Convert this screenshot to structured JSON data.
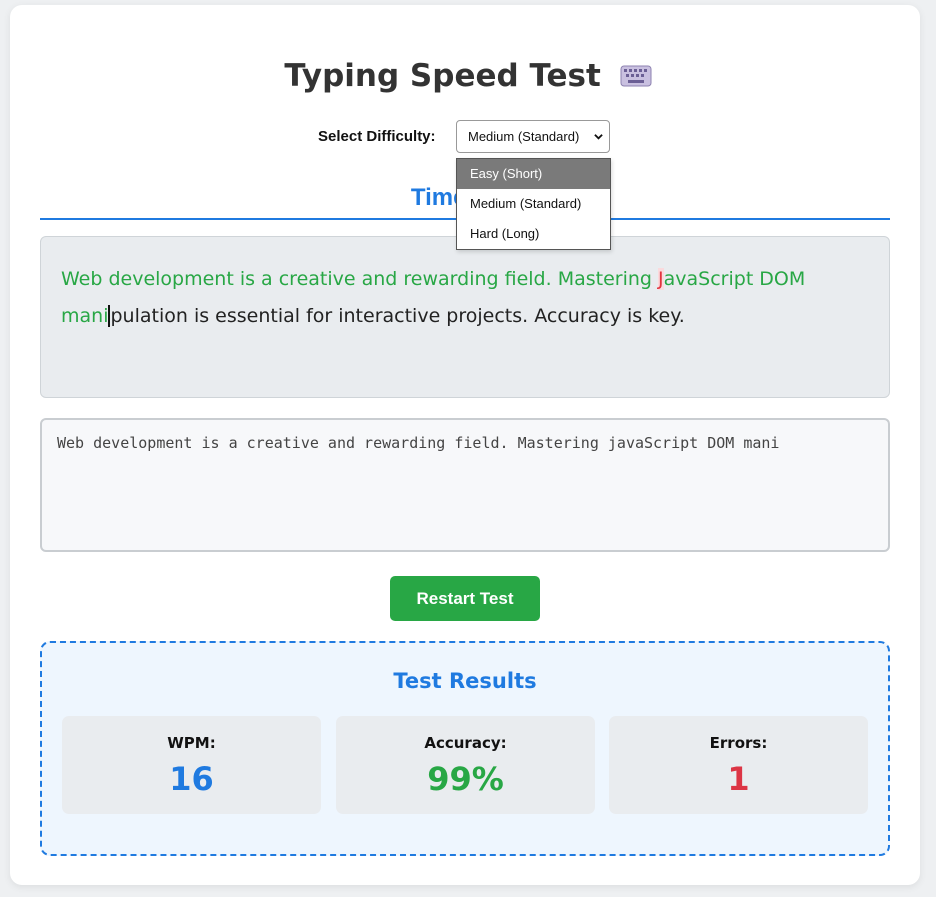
{
  "app": {
    "title": "Typing Speed Test"
  },
  "difficulty": {
    "label": "Select Difficulty:",
    "selected": "Medium (Standard)",
    "options": [
      "Easy (Short)",
      "Medium (Standard)",
      "Hard (Long)"
    ],
    "highlighted": "Easy (Short)"
  },
  "timer": {
    "visible_text": "Time Rem"
  },
  "passage": {
    "correct_1": "Web development is a creative and rewarding field. Mastering ",
    "error_char": "J",
    "correct_2": "avaScript DOM mani",
    "cursor_char": "p",
    "remaining": "ulation is essential for interactive projects. Accuracy is key."
  },
  "input": {
    "value": "Web development is a creative and rewarding field. Mastering javaScript DOM mani"
  },
  "buttons": {
    "restart": "Restart Test"
  },
  "results": {
    "title": "Test Results",
    "wpm_label": "WPM:",
    "wpm_value": "16",
    "accuracy_label": "Accuracy:",
    "accuracy_value": "99%",
    "errors_label": "Errors:",
    "errors_value": "1"
  },
  "colors": {
    "accent_blue": "#1f7ae0",
    "correct_green": "#28a745",
    "error_red": "#e3343f"
  },
  "icons": {
    "title_icon": "keyboard-icon",
    "select_icon": "chevron-down-icon"
  }
}
